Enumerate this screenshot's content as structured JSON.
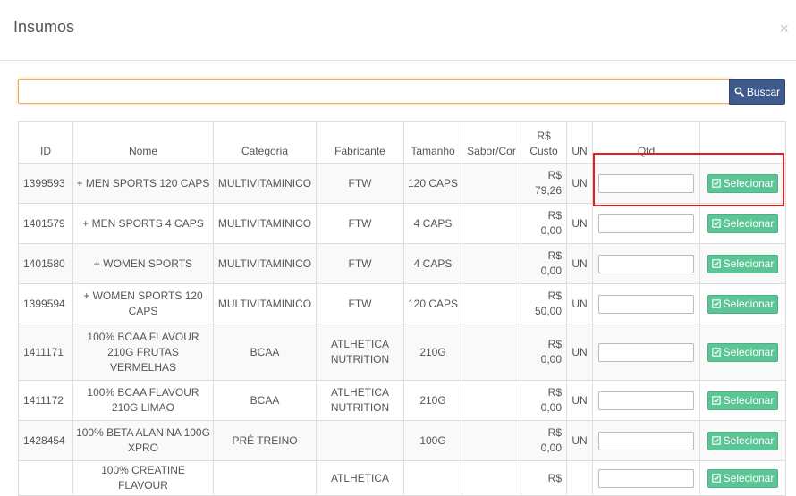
{
  "modal": {
    "title": "Insumos",
    "close": "×"
  },
  "search": {
    "value": "",
    "placeholder": "",
    "button_label": "Buscar"
  },
  "table": {
    "headers": {
      "id": "ID",
      "nome": "Nome",
      "categoria": "Categoria",
      "fabricante": "Fabricante",
      "tamanho": "Tamanho",
      "sabor": "Sabor/Cor",
      "custo_line1": "R$",
      "custo_line2": "Custo",
      "un": "UN",
      "qtd": "Qtd"
    },
    "select_label": "Selecionar",
    "rows": [
      {
        "id": "1399593",
        "nome": "+ MEN SPORTS 120 CAPS",
        "categoria": "MULTIVITAMINICO",
        "fabricante": "FTW",
        "tamanho": "120 CAPS",
        "sabor": "",
        "currency": "R$",
        "custo": "79,26",
        "un": "UN"
      },
      {
        "id": "1401579",
        "nome": "+ MEN SPORTS 4 CAPS",
        "categoria": "MULTIVITAMINICO",
        "fabricante": "FTW",
        "tamanho": "4 CAPS",
        "sabor": "",
        "currency": "R$",
        "custo": "0,00",
        "un": "UN"
      },
      {
        "id": "1401580",
        "nome": "+ WOMEN SPORTS",
        "categoria": "MULTIVITAMINICO",
        "fabricante": "FTW",
        "tamanho": "4 CAPS",
        "sabor": "",
        "currency": "R$",
        "custo": "0,00",
        "un": "UN"
      },
      {
        "id": "1399594",
        "nome": "+ WOMEN SPORTS 120 CAPS",
        "categoria": "MULTIVITAMINICO",
        "fabricante": "FTW",
        "tamanho": "120 CAPS",
        "sabor": "",
        "currency": "R$",
        "custo": "50,00",
        "un": "UN"
      },
      {
        "id": "1411171",
        "nome": "100% BCAA FLAVOUR 210G FRUTAS VERMELHAS",
        "categoria": "BCAA",
        "fabricante": "ATLHETICA NUTRITION",
        "tamanho": "210G",
        "sabor": "",
        "currency": "R$",
        "custo": "0,00",
        "un": "UN"
      },
      {
        "id": "1411172",
        "nome": "100% BCAA FLAVOUR 210G LIMAO",
        "categoria": "BCAA",
        "fabricante": "ATLHETICA NUTRITION",
        "tamanho": "210G",
        "sabor": "",
        "currency": "R$",
        "custo": "0,00",
        "un": "UN"
      },
      {
        "id": "1428454",
        "nome": "100% BETA ALANINA 100G XPRO",
        "categoria": "PRÉ TREINO",
        "fabricante": "",
        "tamanho": "100G",
        "sabor": "",
        "currency": "R$",
        "custo": "0,00",
        "un": "UN"
      },
      {
        "id": "",
        "nome": "100% CREATINE FLAVOUR",
        "categoria": "",
        "fabricante": "ATLHETICA",
        "tamanho": "",
        "sabor": "",
        "currency": "R$",
        "custo": "",
        "un": ""
      }
    ]
  },
  "colors": {
    "search_border": "#f0ad4e",
    "search_button": "#3f5a8c",
    "select_button": "#5bc596",
    "highlight": "#e02020"
  },
  "icons": {
    "search_button": "search-icon",
    "select_button": "check-square-icon",
    "close": "close-icon"
  }
}
